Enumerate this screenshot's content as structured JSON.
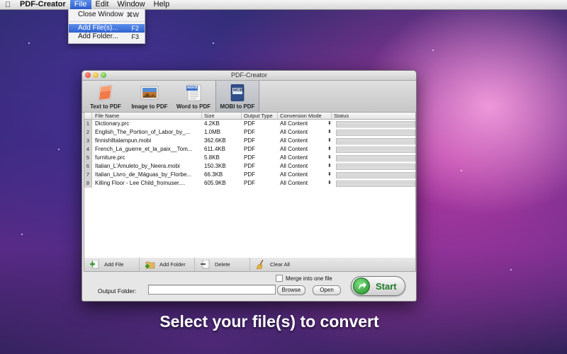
{
  "menubar": {
    "app_name": "PDF-Creator",
    "menus": [
      "File",
      "Edit",
      "Window",
      "Help"
    ]
  },
  "file_menu": {
    "items": [
      {
        "label": "Close Window",
        "shortcut": "⌘W"
      },
      {
        "label": "Add File(s)...",
        "shortcut": "F2"
      },
      {
        "label": "Add Folder...",
        "shortcut": "F3"
      }
    ]
  },
  "window": {
    "title": "PDF-Creator",
    "toolbar": [
      {
        "label": "Text to PDF",
        "icon": "text-pdf-icon"
      },
      {
        "label": "Image to PDF",
        "icon": "image-pdf-icon"
      },
      {
        "label": "Word to PDF",
        "icon": "word-pdf-icon",
        "badge": "word"
      },
      {
        "label": "MOBI to PDF",
        "icon": "mobi-pdf-icon",
        "badge": "MOBI"
      }
    ],
    "table": {
      "headers": [
        "File Name",
        "Size",
        "Output Type",
        "Conversion Mode",
        "Status"
      ],
      "rows": [
        {
          "num": "1",
          "name": "Dictionary.prc",
          "size": "4.2KB",
          "type": "PDF",
          "mode": "All Content"
        },
        {
          "num": "2",
          "name": "English_The_Portion_of_Labor_by_...",
          "size": "1.0MB",
          "type": "PDF",
          "mode": "All Content"
        },
        {
          "num": "3",
          "name": "finnishlltalampun.mobi",
          "size": "362.6KB",
          "type": "PDF",
          "mode": "All Content"
        },
        {
          "num": "4",
          "name": "French_La_guerre_et_la_paix__Tom...",
          "size": "611.4KB",
          "type": "PDF",
          "mode": "All Content"
        },
        {
          "num": "5",
          "name": "furniture.prc",
          "size": "5.8KB",
          "type": "PDF",
          "mode": "All Content"
        },
        {
          "num": "6",
          "name": "Italian_L'Amuleto_by_Neera.mobi",
          "size": "150.3KB",
          "type": "PDF",
          "mode": "All Content"
        },
        {
          "num": "7",
          "name": "Italian_Livro_de_Máguas_by_Florbe...",
          "size": "66.3KB",
          "type": "PDF",
          "mode": "All Content"
        },
        {
          "num": "8",
          "name": "Killing Floor - Lee Child_fromuser....",
          "size": "605.9KB",
          "type": "PDF",
          "mode": "All Content"
        }
      ]
    },
    "bottom_toolbar": {
      "add_file": "Add File",
      "add_folder": "Add Folder",
      "delete": "Delete",
      "clear_all": "Clear All"
    },
    "merge_label": "Merge into one file",
    "output_folder_label": "Output Folder:",
    "output_folder_value": "",
    "browse": "Browse",
    "open": "Open",
    "start": "Start"
  },
  "caption": "Select your file(s) to convert"
}
